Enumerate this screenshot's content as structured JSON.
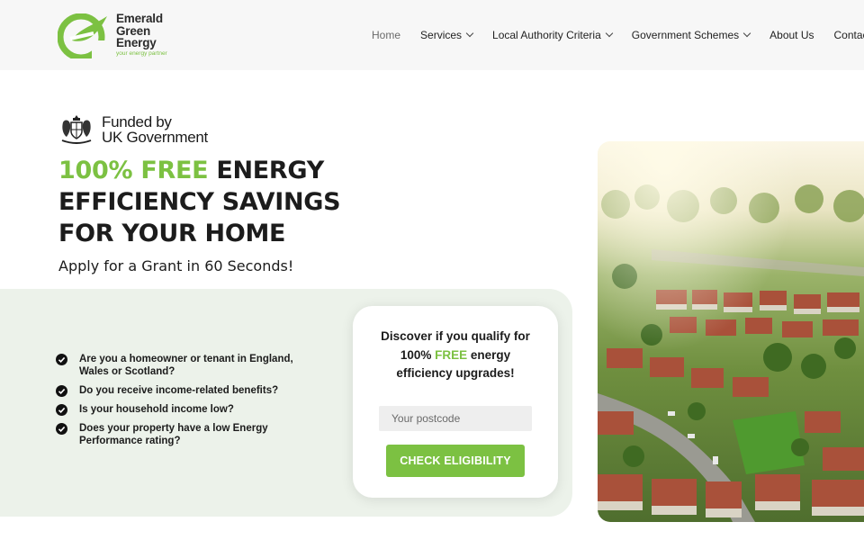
{
  "brand": {
    "name_line1": "Emerald",
    "name_line2": "Green",
    "name_line3": "Energy",
    "tagline": "your energy partner",
    "accent_color": "#7cc142"
  },
  "nav": {
    "items": [
      {
        "label": "Home",
        "has_dropdown": false
      },
      {
        "label": "Services",
        "has_dropdown": true
      },
      {
        "label": "Local Authority Criteria",
        "has_dropdown": true
      },
      {
        "label": "Government Schemes",
        "has_dropdown": true
      },
      {
        "label": "About Us",
        "has_dropdown": false
      },
      {
        "label": "Contact",
        "has_dropdown": false
      }
    ]
  },
  "hero": {
    "funded_line1": "Funded by",
    "funded_line2": "UK Government",
    "headline_green": "100% FREE",
    "headline_rest1": " ENERGY",
    "headline_line2": "EFFICIENCY SAVINGS",
    "headline_line3": "FOR YOUR HOME",
    "subhead": "Apply for a Grant in 60 Seconds!"
  },
  "checklist": [
    "Are you a homeowner or tenant in England, Wales or Scotland?",
    "Do you receive income-related benefits?",
    "Is your household income low?",
    "Does your property have a low Energy Performance rating?"
  ],
  "card": {
    "title_line1": "Discover if you qualify for",
    "title_pre": "100% ",
    "title_green": "FREE",
    "title_post": " energy",
    "title_line3": "efficiency upgrades!",
    "postcode_placeholder": "Your postcode",
    "postcode_value": "",
    "button_label": "CHECK ELIGIBILITY"
  },
  "icons": {
    "logo": "leaf-e-logo-icon",
    "crest": "royal-coat-of-arms-icon",
    "check": "check-circle-icon",
    "dropdown": "chevron-down-icon"
  }
}
